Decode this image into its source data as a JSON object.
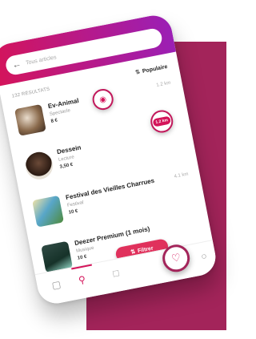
{
  "search": {
    "placeholder": "Tous articles"
  },
  "list": {
    "results_label": "132 RÉSULTATS",
    "sort_label": "Populaire",
    "items": [
      {
        "title": "Ev-Animal",
        "subtitle": "Spectacle",
        "price": "8 €",
        "distance": "1.2 km"
      },
      {
        "title": "Dessein",
        "subtitle": "Lecture",
        "price": "3,50 €",
        "distance": ""
      },
      {
        "title": "Festival des Vieilles Charrues",
        "subtitle": "Festival",
        "price": "10 €",
        "distance": "4.1 km"
      },
      {
        "title": "Deezer Premium (1 mois)",
        "subtitle": "Musique",
        "price": "10 €",
        "distance": ""
      }
    ]
  },
  "badges": {
    "distance": "1.2 km"
  },
  "filter": {
    "label": "Filtrer",
    "icon": "filter-icon"
  },
  "nav": {
    "items": [
      {
        "icon": "home-icon"
      },
      {
        "icon": "search-icon"
      },
      {
        "icon": "message-icon"
      },
      {
        "icon": "heart-icon"
      },
      {
        "icon": "user-icon"
      }
    ]
  },
  "colors": {
    "accent": "#d4145a",
    "accent_dark": "#a3245a",
    "header_end": "#9b1fb5"
  }
}
